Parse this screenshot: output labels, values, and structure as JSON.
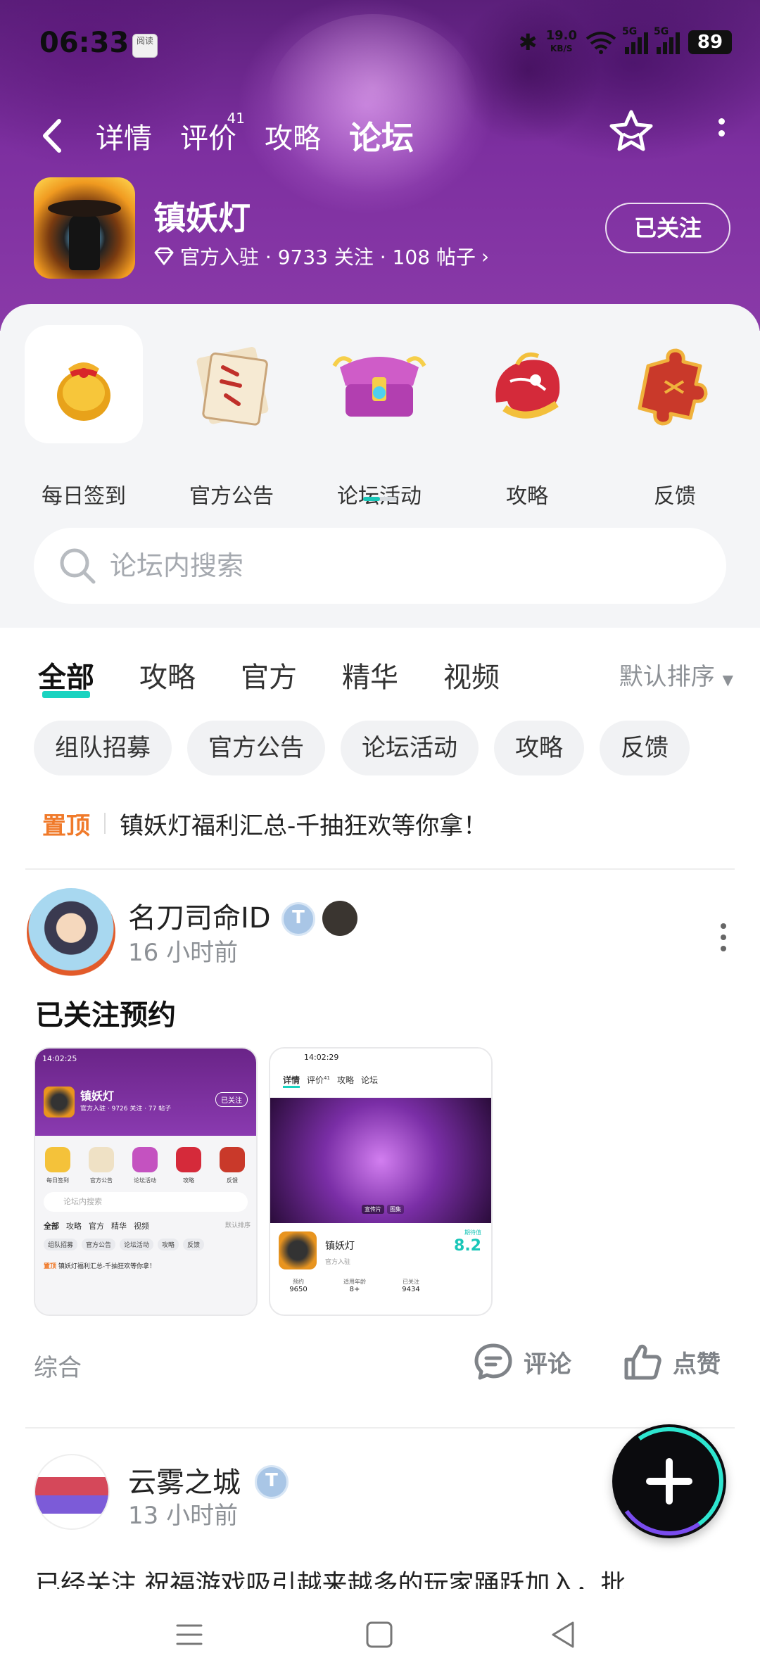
{
  "status_bar": {
    "time": "06:33",
    "app_badge": "阅读",
    "net_speed_value": "19.0",
    "net_speed_unit": "KB/S",
    "signal1_label": "5G",
    "signal2_label": "5G",
    "battery": "89"
  },
  "top_tabs": [
    {
      "label": "详情",
      "active": false
    },
    {
      "label": "评价",
      "badge": "41",
      "active": false
    },
    {
      "label": "攻略",
      "active": false
    },
    {
      "label": "论坛",
      "active": true
    }
  ],
  "game": {
    "name": "镇妖灯",
    "meta": "官方入驻 · 9733 关注 · 108 帖子",
    "follow_label": "已关注"
  },
  "quick_entries": [
    {
      "label": "每日签到",
      "icon": "lucky-bag-icon"
    },
    {
      "label": "官方公告",
      "icon": "scroll-icon"
    },
    {
      "label": "论坛活动",
      "icon": "treasure-chest-icon"
    },
    {
      "label": "攻略",
      "icon": "dragon-icon"
    },
    {
      "label": "反馈",
      "icon": "puzzle-icon"
    }
  ],
  "search": {
    "placeholder": "论坛内搜索"
  },
  "filter_tabs": [
    {
      "label": "全部",
      "active": true
    },
    {
      "label": "攻略",
      "active": false
    },
    {
      "label": "官方",
      "active": false
    },
    {
      "label": "精华",
      "active": false
    },
    {
      "label": "视频",
      "active": false
    }
  ],
  "sort_label": "默认排序",
  "chips": [
    "组队招募",
    "官方公告",
    "论坛活动",
    "攻略",
    "反馈"
  ],
  "pinned": {
    "tag": "置顶",
    "text": "镇妖灯福利汇总-千抽狂欢等你拿！"
  },
  "posts": [
    {
      "author": "名刀司命ID",
      "time": "16 小时前",
      "title": "已关注预约",
      "category": "综合",
      "comment_label": "评论",
      "like_label": "点赞",
      "shot1": {
        "time": "14:02:25",
        "game": "镇妖灯",
        "meta": "官方入驻 · 9726 关注 · 77 帖子",
        "follow": "已关注",
        "entries": [
          "每日签到",
          "官方公告",
          "论坛活动",
          "攻略",
          "反馈"
        ],
        "search": "论坛内搜索",
        "tabs": [
          "全部",
          "攻略",
          "官方",
          "精华",
          "视频"
        ],
        "sort": "默认排序",
        "chips": [
          "组队招募",
          "官方公告",
          "论坛活动",
          "攻略",
          "反馈"
        ],
        "pinned_tag": "置顶",
        "pinned": "镇妖灯福利汇总-千抽狂欢等你拿！"
      },
      "shot2": {
        "time": "14:02:29",
        "tabs": [
          "详情",
          "评价",
          "攻略",
          "论坛"
        ],
        "tab_badge": "41",
        "banner_tabs": [
          "宣传片",
          "图集"
        ],
        "game": "镇妖灯",
        "official": "官方入驻",
        "score_label": "期待值",
        "score": "8.2",
        "stats": [
          {
            "label": "预约",
            "value": "9650"
          },
          {
            "label": "适用年龄",
            "value": "8+"
          },
          {
            "label": "已关注",
            "value": "9434"
          }
        ]
      }
    },
    {
      "author": "云雾之城",
      "time": "13 小时前",
      "text": "已经关注 祝福游戏吸引越来越多的玩家踊跃加入，批"
    }
  ],
  "colors": {
    "accent": "#19d3c0",
    "header_purple": "#7d2fa0",
    "pinned_orange": "#f07a2a"
  }
}
